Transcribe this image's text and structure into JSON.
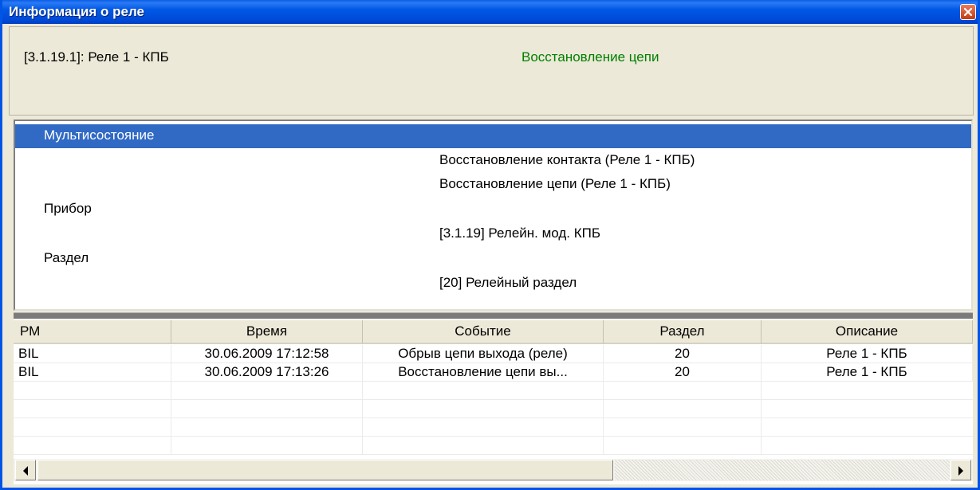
{
  "window": {
    "title": "Информация о реле"
  },
  "info": {
    "relay_name": "[3.1.19.1]: Реле 1 - КПБ",
    "state": "Восстановление цепи",
    "state_color": "#008000"
  },
  "properties": {
    "groups": [
      {
        "label": "Мультисостояние",
        "selected": true,
        "values": [
          "Восстановление контакта (Реле 1 - КПБ)",
          "Восстановление цепи (Реле 1 - КПБ)"
        ]
      },
      {
        "label": "Прибор",
        "selected": false,
        "values": [
          "[3.1.19] Релейн. мод. КПБ"
        ]
      },
      {
        "label": "Раздел",
        "selected": false,
        "values": [
          "[20] Релейный раздел"
        ]
      }
    ]
  },
  "events_table": {
    "columns": [
      "РМ",
      "Время",
      "Событие",
      "Раздел",
      "Описание"
    ],
    "rows": [
      [
        "BIL",
        "30.06.2009 17:12:58",
        "Обрыв цепи выхода (реле)",
        "20",
        "Реле 1 - КПБ"
      ],
      [
        "BIL",
        "30.06.2009 17:13:26",
        "Восстановление цепи вы...",
        "20",
        "Реле 1 - КПБ"
      ]
    ]
  },
  "colors": {
    "titlebar": "#0055E5",
    "selection": "#316AC5",
    "window_bg": "#ECE9D8"
  },
  "icons": {
    "close": "close-icon",
    "scroll_left": "arrow-left-icon",
    "scroll_right": "arrow-right-icon"
  }
}
